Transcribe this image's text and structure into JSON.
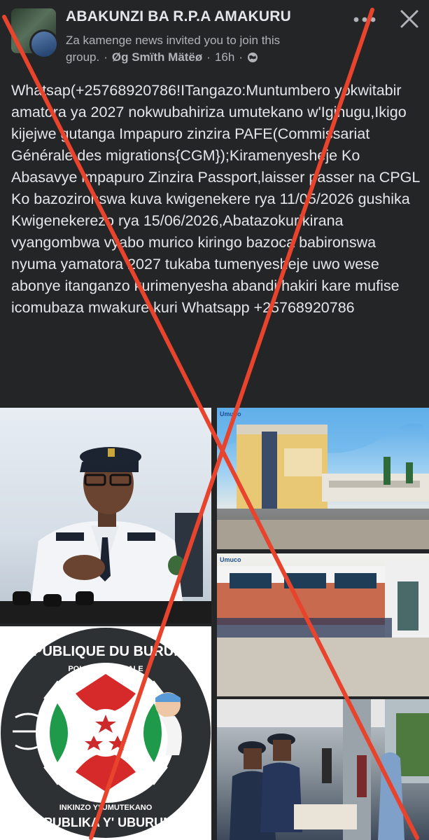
{
  "header": {
    "group_name": "ABAKUNZI BA R.P.A AMAKURU",
    "invite_text": "Za kamenge news invited you to join this",
    "group_word": "group.",
    "separator": "·",
    "author": "Øg Smïth Mätëø",
    "time": "16h",
    "separator2": "·",
    "globe_icon": "globe-icon",
    "more_icon": "more-horizontal-icon",
    "close_icon": "close-icon"
  },
  "post": {
    "text": "Whatsap(+25768920786!ITangazo:Muntumbero yokwitabir amatora ya 2027 nokwubahiriza umutekano w'Igihugu,Ikigo  kijejwe gutanga Impapuro zinzira PAFE(Commissariat Générale des migrations{CGM});Kiramenyesheje Ko Abasavye impapuro Zinzira Passport,laisser passer na CPGL Ko bazozironswa kuva kwigenekere rya 11/05/2026 gushika Kwigenekerezo rya 15/06/2026,Abatazokurikirana vyangombwa vyabo murico kiringo bazoca babironswa nyuma yamatora 2027 tukaba tumenyesheje uwo wese abonye itanganzo kurimenyesha abandi hakiri kare mufise icomubaza mwakure kuri Whatsapp +25768920786"
  },
  "photos": {
    "building1_tag": "Umuco",
    "building2_tag": "Umuco",
    "logo_top": "REPUBLIQUE DU BURUNDI",
    "logo_sub": "POLICE NATIONALE",
    "logo_motto": "INKINZO Y' UMUTEKANO",
    "logo_bottom": "REPUBLIKA Y' UBURUNDI"
  },
  "colors": {
    "background": "#242526",
    "cross": "#e8432c",
    "text": "#e4e6eb",
    "secondary_text": "#b0b3b8"
  }
}
